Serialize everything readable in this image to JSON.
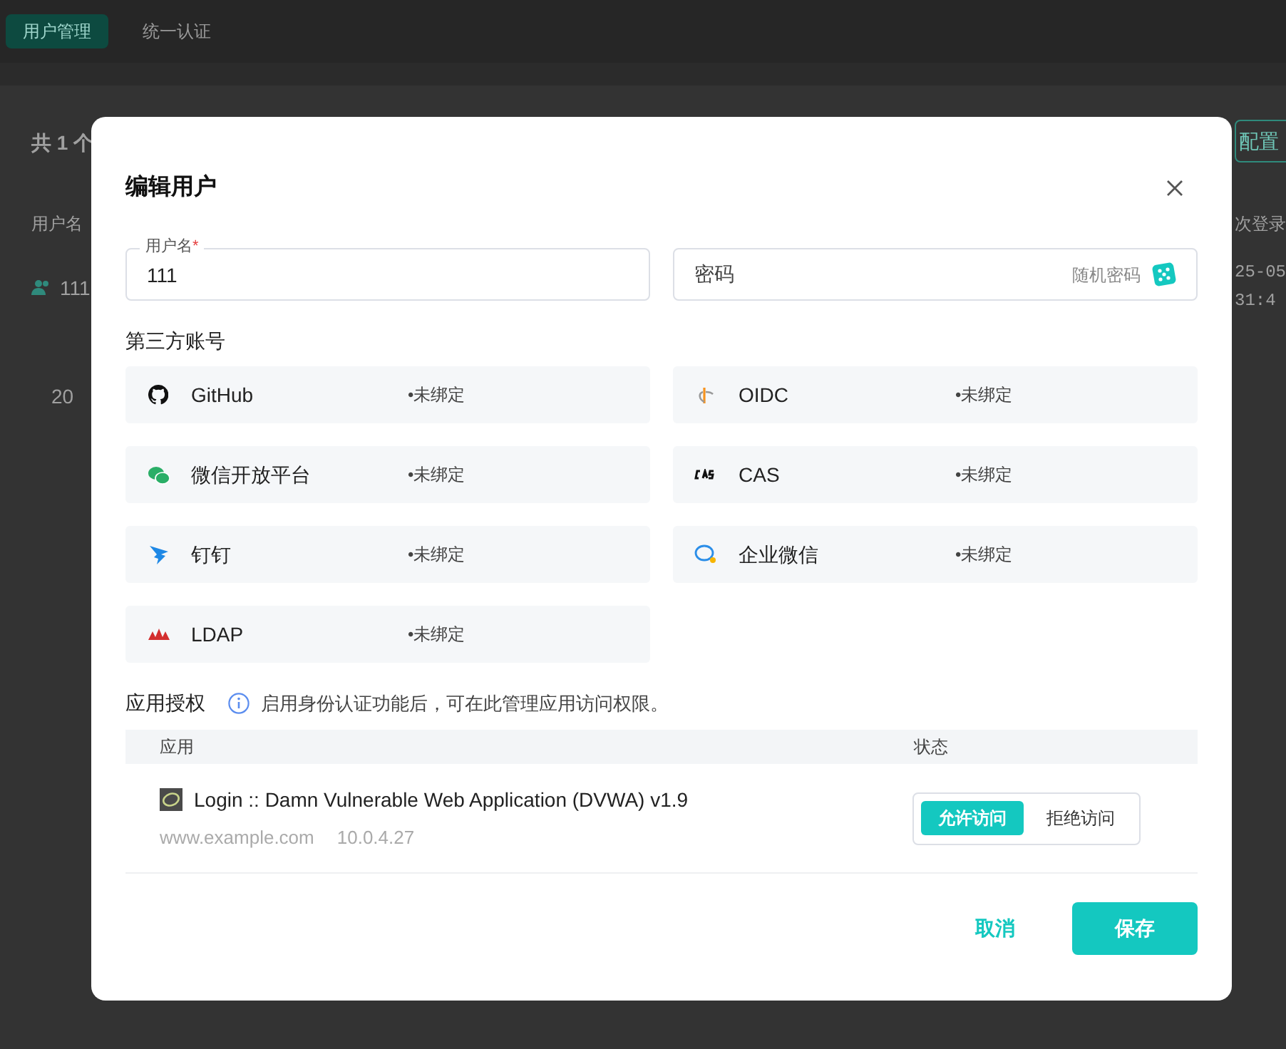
{
  "background": {
    "tabs": [
      {
        "label": "用户管理",
        "selected": true
      },
      {
        "label": "统一认证",
        "selected": false
      }
    ],
    "count": "共 1 个",
    "config_button": "配置",
    "columns": [
      "用户名",
      "次登录"
    ],
    "row": {
      "username": "111",
      "date": "25-05",
      "time": "31:4"
    },
    "page_size": "20"
  },
  "dialog": {
    "title": "编辑用户",
    "username_field": {
      "label": "用户名",
      "required_mark": "*",
      "value": "111"
    },
    "password_field": {
      "placeholder": "密码",
      "random_label": "随机密码"
    },
    "third_party_title": "第三方账号",
    "accounts": [
      {
        "kind": "github",
        "name": "GitHub",
        "status": "•未绑定"
      },
      {
        "kind": "oidc",
        "name": "OIDC",
        "status": "•未绑定"
      },
      {
        "kind": "wechat",
        "name": "微信开放平台",
        "status": "•未绑定"
      },
      {
        "kind": "cas",
        "name": "CAS",
        "status": "•未绑定"
      },
      {
        "kind": "dingtalk",
        "name": "钉钉",
        "status": "•未绑定"
      },
      {
        "kind": "wecom",
        "name": "企业微信",
        "status": "•未绑定"
      },
      {
        "kind": "ldap",
        "name": "LDAP",
        "status": "•未绑定"
      }
    ],
    "app_auth": {
      "title": "应用授权",
      "hint": "启用身份认证功能后，可在此管理应用访问权限。",
      "columns": [
        "应用",
        "状态"
      ],
      "apps": [
        {
          "name": "Login :: Damn Vulnerable Web Application (DVWA) v1.9",
          "domain": "www.example.com",
          "ip": "10.0.4.27",
          "options": [
            {
              "label": "允许访问",
              "selected": true
            },
            {
              "label": "拒绝访问",
              "selected": false
            }
          ]
        }
      ]
    },
    "buttons": {
      "cancel": "取消",
      "save": "保存"
    }
  }
}
